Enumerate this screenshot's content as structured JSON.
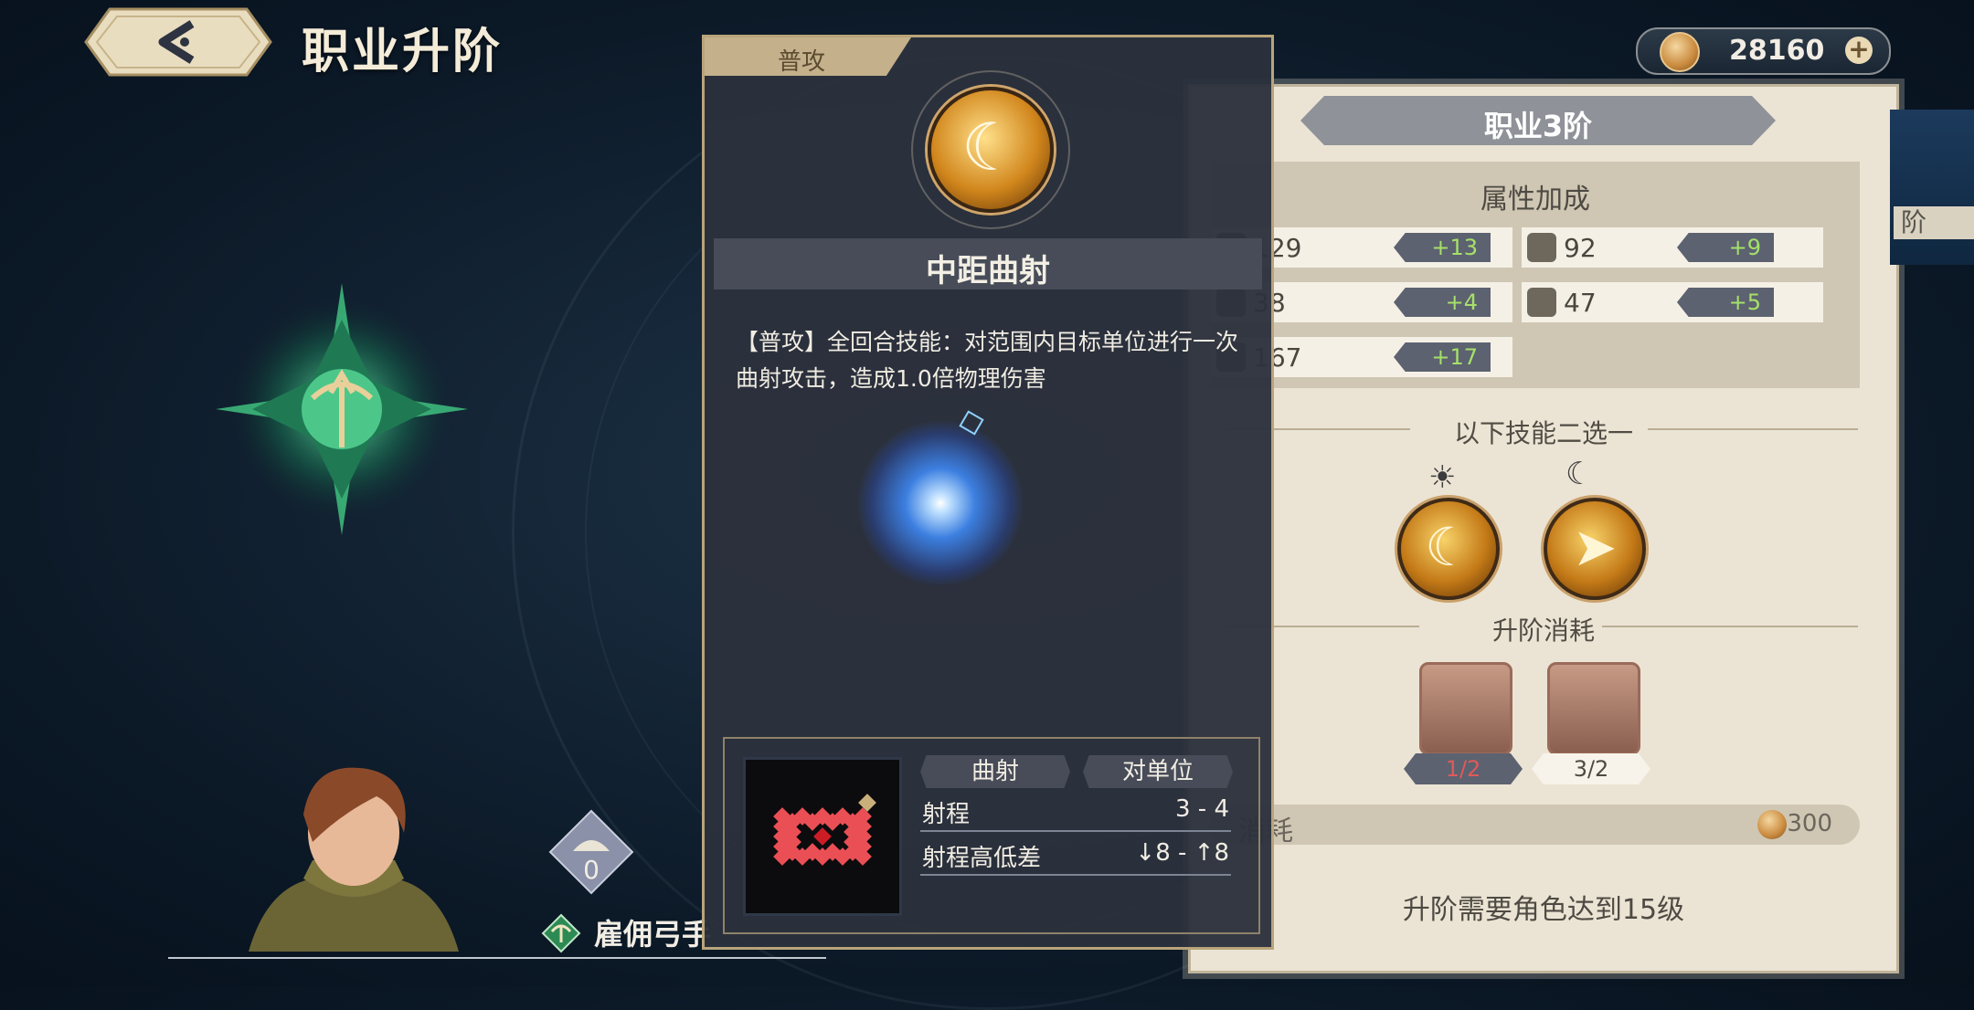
{
  "header": {
    "title": "职业升阶",
    "back_icon": "back-arrow-icon"
  },
  "currency": {
    "amount": "28160",
    "coin_icon": "gold-coin-icon",
    "add_icon": "plus-icon"
  },
  "skill_popup": {
    "tab_label": "普攻",
    "skill_name": "中距曲射",
    "description": "【普攻】全回合技能：对范围内目标单位进行一次曲射攻击，造成1.0倍物理伤害",
    "tags": [
      "曲射",
      "对单位"
    ],
    "stats": [
      {
        "label": "射程",
        "value": "3 - 4"
      },
      {
        "label": "射程高低差",
        "value": "↓8 - ↑8"
      }
    ]
  },
  "rank_panel": {
    "rank_title": "职业3阶",
    "attr_title": "属性加成",
    "stats": [
      {
        "value": "129",
        "bonus": "+13",
        "icon": "sword-icon"
      },
      {
        "value": "92",
        "bonus": "+9",
        "icon": "magic-wand-icon"
      },
      {
        "value": "38",
        "bonus": "+4",
        "icon": "shield-icon"
      },
      {
        "value": "47",
        "bonus": "+5",
        "icon": "wizard-hat-icon"
      },
      {
        "value": "167",
        "bonus": "+17",
        "icon": "heart-icon"
      }
    ],
    "skill_choice_title": "以下技能二选一",
    "skill_options": [
      {
        "icon": "curved-shot-icon",
        "time_icon": "sun-icon"
      },
      {
        "icon": "arrow-pierce-icon",
        "time_icon": "moon-icon"
      }
    ],
    "upgrade_cost_title": "升阶消耗",
    "items": [
      {
        "count": "1/2",
        "icon": "emblem-item-icon"
      },
      {
        "count": "3/2",
        "icon": "tome-item-icon"
      }
    ],
    "cost_label": "消耗",
    "cost_value": "300",
    "requirement": "升阶需要角色达到15级"
  },
  "right_edge_label": "阶",
  "character": {
    "level": "0",
    "class_name": "雇佣弓手"
  },
  "colors": {
    "panel_bg": "#ebe4d4",
    "popup_bg": "#2c313c",
    "bonus_green": "#a6e06a",
    "insufficient_red": "#e05a5a"
  }
}
